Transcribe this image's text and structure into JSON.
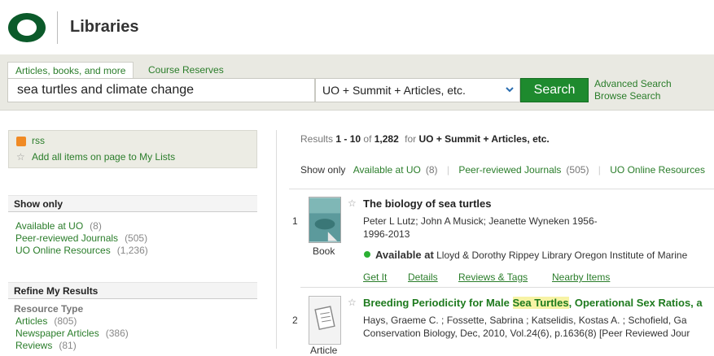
{
  "header": {
    "site_title": "Libraries",
    "logo_icon": "uo-logo-icon"
  },
  "search": {
    "tabs": [
      "Articles, books, and more",
      "Course Reserves"
    ],
    "query": "sea turtles and climate change",
    "scope": "UO + Summit + Articles, etc.",
    "button_label": "Search",
    "advanced_label": "Advanced Search",
    "browse_label": "Browse Search"
  },
  "sidebar": {
    "rss_label": "rss",
    "add_all_label": "Add all items on page to My Lists",
    "show_only_heading": "Show only",
    "show_only": [
      {
        "label": "Available at UO",
        "count": "(8)"
      },
      {
        "label": "Peer-reviewed Journals",
        "count": "(505)"
      },
      {
        "label": "UO Online Resources",
        "count": "(1,236)"
      }
    ],
    "refine_heading": "Refine My Results",
    "resource_type_label": "Resource Type",
    "resource_types": [
      {
        "label": "Articles",
        "count": "(805)"
      },
      {
        "label": "Newspaper Articles",
        "count": "(386)"
      },
      {
        "label": "Reviews",
        "count": "(81)"
      }
    ]
  },
  "results": {
    "summary_prefix": "Results",
    "range": "1 - 10",
    "of_label": "of",
    "total": "1,282",
    "for_label": "for",
    "scope": "UO + Summit + Articles, etc.",
    "show_only_label": "Show only",
    "filters": [
      {
        "label": "Available at UO",
        "count": "(8)"
      },
      {
        "label": "Peer-reviewed Journals",
        "count": "(505)"
      },
      {
        "label": "UO Online Resources",
        "count": ""
      }
    ],
    "items": [
      {
        "num": "1",
        "title": "The biology of sea turtles",
        "authors": "Peter L Lutz; John A Musick; Jeanette Wyneken 1956-",
        "date": "1996-2013",
        "availability_prefix": "Available at",
        "availability_location": "Lloyd & Dorothy Rippey Library Oregon Institute of Marine",
        "format": "Book",
        "actions": [
          "Get It",
          "Details",
          "Reviews & Tags",
          "Nearby Items"
        ]
      },
      {
        "num": "2",
        "title_before": "Breeding Periodicity for Male ",
        "title_highlight": "Sea Turtles",
        "title_after": ", Operational Sex Ratios, a",
        "authors": "Hays, Graeme C. ; Fossette, Sabrina ; Katselidis, Kostas A. ; Schofield, Ga",
        "source": "Conservation Biology, Dec, 2010, Vol.24(6), p.1636(8) [Peer Reviewed Jour",
        "format": "Article"
      }
    ]
  },
  "colors": {
    "accent": "#1e8a2e",
    "link": "#2a7d2a",
    "available": "#2bb033",
    "highlight": "#f7f3a5"
  }
}
